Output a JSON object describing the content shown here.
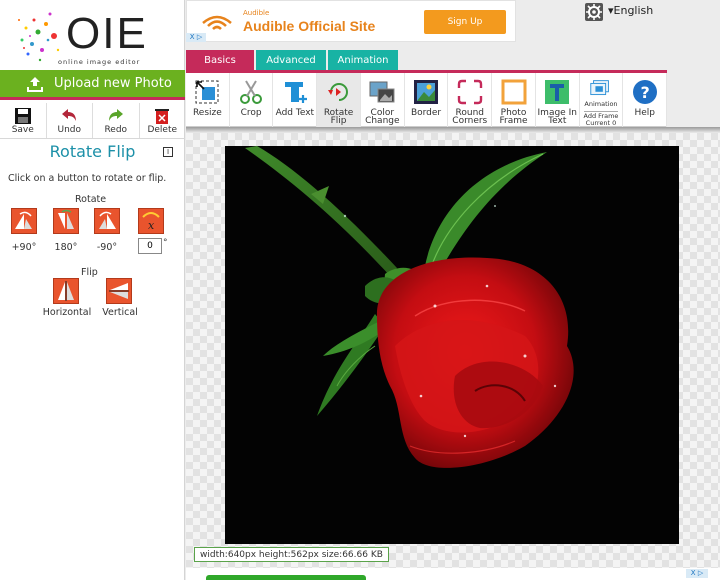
{
  "logo": {
    "mark": "OIE",
    "subtitle": "online image editor"
  },
  "upload": {
    "label": "Upload new Photo",
    "icon": "upload-icon"
  },
  "actions": [
    {
      "label": "Save",
      "icon": "save-icon"
    },
    {
      "label": "Undo",
      "icon": "undo-icon"
    },
    {
      "label": "Redo",
      "icon": "redo-icon"
    },
    {
      "label": "Delete",
      "icon": "delete-icon"
    }
  ],
  "panel": {
    "title": "Rotate Flip",
    "minimize_glyph": "I",
    "instruction": "Click on a button to rotate or flip.",
    "rotate_label": "Rotate",
    "flip_label": "Flip",
    "rotate_buttons": [
      "+90°",
      "180°",
      "-90°"
    ],
    "custom_value": "0",
    "degree_symbol": "°",
    "flip_buttons": [
      "Horizontal",
      "Vertical"
    ]
  },
  "ad": {
    "brand_small": "Audible",
    "title": "Audible Official Site",
    "button": "Sign Up",
    "close_glyph": "X ▷",
    "accent": "#e7831c"
  },
  "language": "▾English",
  "tabs": [
    "Basics",
    "Advanced",
    "Animation"
  ],
  "tools": [
    {
      "label": "Resize",
      "icon": "resize-icon"
    },
    {
      "label": "Crop",
      "icon": "crop-scissors-icon"
    },
    {
      "label": "Add Text",
      "icon": "add-text-icon"
    },
    {
      "label": "Rotate Flip",
      "icon": "rotate-flip-icon",
      "active": true
    },
    {
      "label": "Color Change",
      "icon": "color-change-icon"
    },
    {
      "label": "Border",
      "icon": "border-icon"
    },
    {
      "label": "Round Corners",
      "icon": "round-corners-icon"
    },
    {
      "label": "Photo Frame",
      "icon": "photo-frame-icon"
    },
    {
      "label": "Image In Text",
      "icon": "image-in-text-icon"
    },
    {
      "label": "Animation",
      "sub1": "Add Frame",
      "sub2": "Current 0",
      "icon": "animation-icon"
    },
    {
      "label": "Help",
      "icon": "help-icon"
    }
  ],
  "image_info": "width:640px  height:562px  size:66.66 KB",
  "colors": {
    "upload_green": "#6bb11f",
    "accent_pink": "#c52a5a",
    "teal_tab": "#18b3a4",
    "title_teal": "#1c90a8",
    "tool_button_orange": "#e9542d"
  }
}
